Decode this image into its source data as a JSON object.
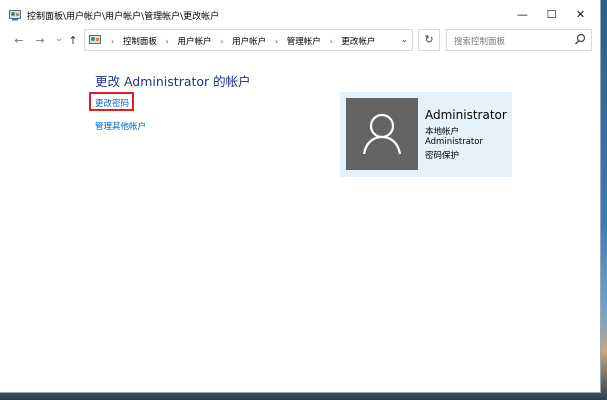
{
  "window": {
    "title": "控制面板\\用户帐户\\用户帐户\\管理帐户\\更改帐户",
    "minimize_glyph": "—",
    "maximize_glyph": "☐",
    "close_glyph": "✕"
  },
  "nav": {
    "back_glyph": "←",
    "forward_glyph": "→",
    "recent_glyph": "⌄",
    "up_glyph": "↑",
    "breadcrumbs": [
      "控制面板",
      "用户帐户",
      "用户帐户",
      "管理帐户",
      "更改帐户"
    ],
    "refresh_glyph": "↻",
    "search_placeholder": "搜索控制面板"
  },
  "content": {
    "heading": "更改 Administrator 的帐户",
    "change_password_link": "更改密码",
    "manage_other_link": "管理其他帐户"
  },
  "account_card": {
    "name": "Administrator",
    "type": "本地帐户",
    "group": "Administrator",
    "protection": "密码保护"
  },
  "colors": {
    "heading": "#1e3287",
    "link": "#0066cc",
    "highlight_box": "#e02020",
    "card_bg": "#e5f1fb",
    "avatar_bg": "#646464"
  },
  "icons": [
    "control-panel-icon",
    "back-arrow-icon",
    "forward-arrow-icon",
    "recent-dropdown-icon",
    "up-arrow-icon",
    "refresh-icon",
    "search-icon",
    "user-icon",
    "chevron-right-icon"
  ]
}
